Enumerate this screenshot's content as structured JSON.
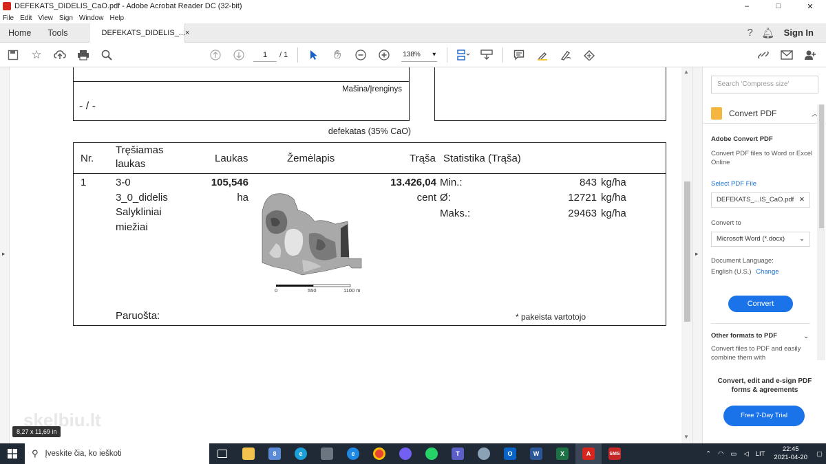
{
  "window": {
    "title": "DEFEKATS_DIDELIS_CaO.pdf - Adobe Acrobat Reader DC (32-bit)",
    "minimize": "–",
    "maximize": "□",
    "close": "✕"
  },
  "menu": [
    "File",
    "Edit",
    "View",
    "Sign",
    "Window",
    "Help"
  ],
  "tabs": {
    "home": "Home",
    "tools": "Tools",
    "document": "DEFEKATS_DIDELIS_...",
    "close": "×",
    "sign_in": "Sign In"
  },
  "toolbar": {
    "page_current": "1",
    "page_total": "/ 1",
    "zoom": "138%"
  },
  "document": {
    "machine_label": "Mašina/Įrenginys",
    "machine_value": "- / -",
    "product_caption": "defekatas (35% CaO)",
    "headers": {
      "nr": "Nr.",
      "field": "Tręšiamas laukas",
      "area": "Laukas",
      "map": "Žemėlapis",
      "rate": "Trąša",
      "stats": "Statistika (Trąša)"
    },
    "row": {
      "nr": "1",
      "field_line1": "3-0",
      "field_line2": "3_0_didelis",
      "field_line3": "Salykliniai",
      "field_line4": "miežiai",
      "area_value": "105,546",
      "area_unit": "ha",
      "rate_value": "13.426,04",
      "rate_unit": "cent",
      "stat_min_label": "Min.:",
      "stat_min_value": "843",
      "stat_avg_label": "Ø:",
      "stat_avg_value": "12721",
      "stat_max_label": "Maks.:",
      "stat_max_value": "29463",
      "stat_unit": "kg/ha"
    },
    "scale": [
      "0",
      "550",
      "1100 m"
    ],
    "prepared_label": "Paruošta:",
    "footnote": "* pakeista vartotojo",
    "page_size": "8,27 x 11,69 in",
    "watermark": "skelbiu.lt"
  },
  "right_pane": {
    "search_placeholder": "Search 'Compress size'",
    "convert_title": "Convert PDF",
    "adobe_convert_title": "Adobe Convert PDF",
    "adobe_convert_desc": "Convert PDF files to Word or Excel Online",
    "select_file": "Select PDF File",
    "file_name": "DEFEKATS_...IS_CaO.pdf",
    "convert_to_label": "Convert to",
    "convert_to_value": "Microsoft Word (*.docx)",
    "language_label": "Document Language:",
    "language_value": "English (U.S.)",
    "language_change": "Change",
    "convert_button": "Convert",
    "other_formats_title": "Other formats to PDF",
    "other_formats_desc": "Convert files to PDF and easily combine them with",
    "promo": "Convert, edit and e-sign PDF forms & agreements",
    "trial_button": "Free 7-Day Trial"
  },
  "taskbar": {
    "search_placeholder": "Įveskite čia, ko ieškoti",
    "language": "LIT",
    "time": "22:45",
    "date": "2021-04-20"
  }
}
